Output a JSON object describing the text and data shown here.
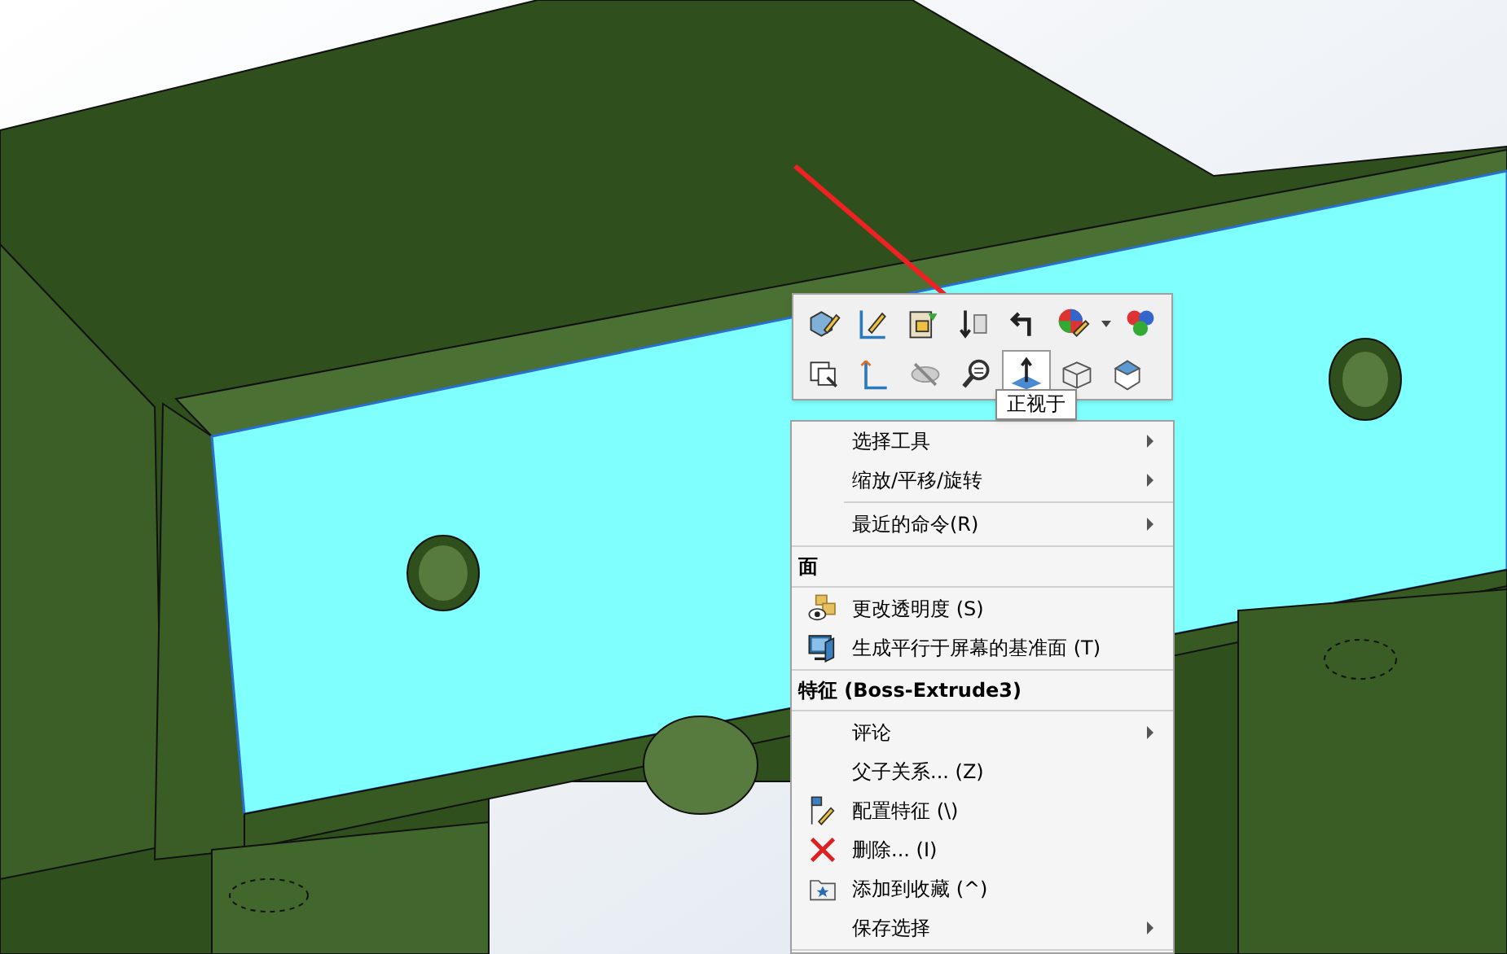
{
  "toolbar": {
    "rows": [
      [
        {
          "selected": false,
          "dropdown": false
        },
        {
          "selected": false,
          "dropdown": false
        },
        {
          "selected": false,
          "dropdown": false
        },
        {
          "selected": false,
          "dropdown": false
        },
        {
          "selected": false,
          "dropdown": false
        },
        {
          "selected": false,
          "dropdown": true
        },
        {
          "selected": false,
          "dropdown": false
        }
      ],
      [
        {
          "selected": false,
          "dropdown": false
        },
        {
          "selected": false,
          "dropdown": false
        },
        {
          "selected": false,
          "dropdown": false
        },
        {
          "selected": false,
          "dropdown": false
        },
        {
          "selected": true,
          "dropdown": false
        },
        {
          "selected": false,
          "dropdown": false
        },
        {
          "selected": false,
          "dropdown": false
        }
      ]
    ]
  },
  "tooltip": "正视于",
  "menu": [
    {
      "kind": "item",
      "label": "选择工具",
      "submenu": true
    },
    {
      "kind": "item",
      "label": "缩放/平移/旋转",
      "submenu": true
    },
    {
      "kind": "separator"
    },
    {
      "kind": "item",
      "label": "最近的命令(R)",
      "submenu": true
    },
    {
      "kind": "separator"
    },
    {
      "kind": "header",
      "label": "面"
    },
    {
      "kind": "separator"
    },
    {
      "kind": "item",
      "label": "更改透明度 (S)",
      "submenu": false
    },
    {
      "kind": "item",
      "label": "生成平行于屏幕的基准面 (T)",
      "submenu": false
    },
    {
      "kind": "separator"
    },
    {
      "kind": "header",
      "label": "特征 (Boss-Extrude3)"
    },
    {
      "kind": "separator"
    },
    {
      "kind": "item",
      "label": "评论",
      "submenu": true
    },
    {
      "kind": "item",
      "label": "父子关系... (Z)",
      "submenu": false
    },
    {
      "kind": "item",
      "label": "配置特征 (\\)",
      "submenu": false
    },
    {
      "kind": "item",
      "label": "删除... (I)",
      "submenu": false
    },
    {
      "kind": "item",
      "label": "添加到收藏 (^)",
      "submenu": false
    },
    {
      "kind": "item",
      "label": "保存选择",
      "submenu": true
    },
    {
      "kind": "separator"
    }
  ]
}
